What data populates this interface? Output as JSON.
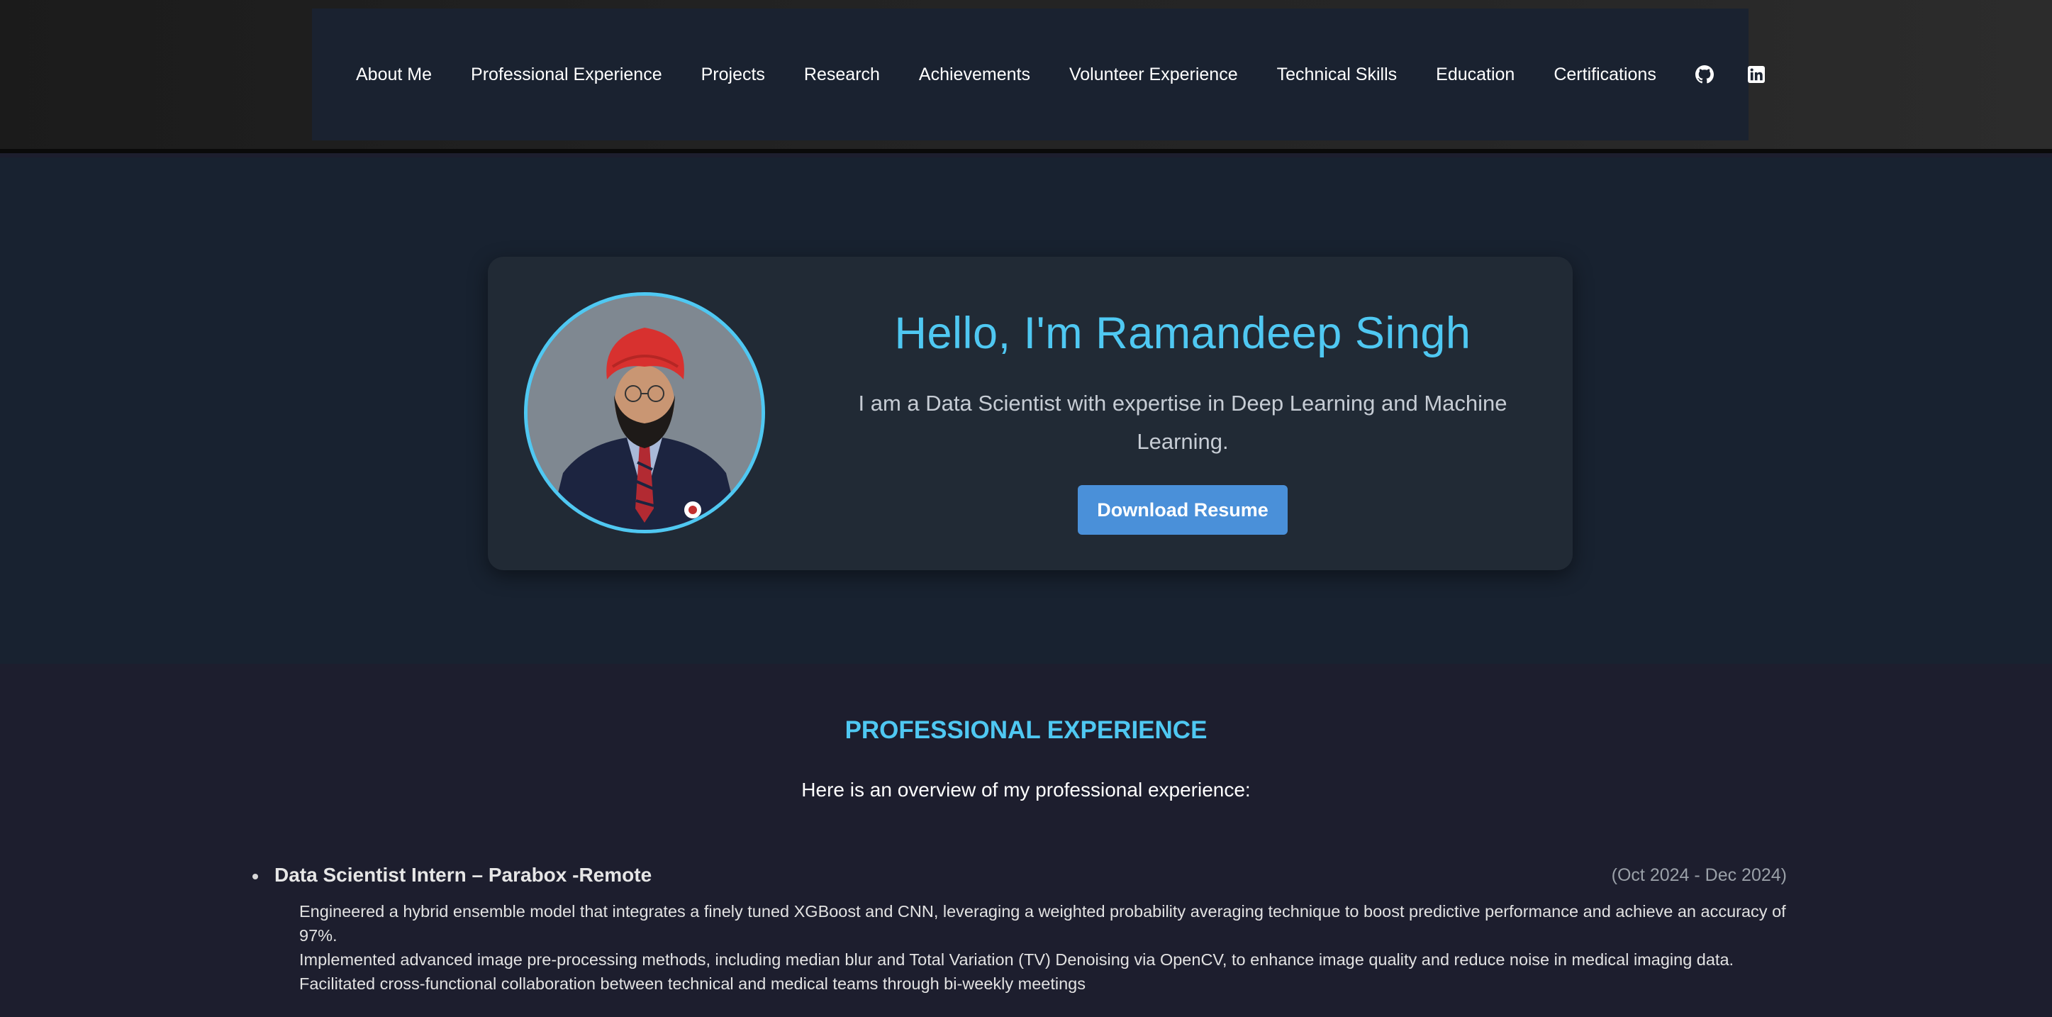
{
  "nav": {
    "items": [
      {
        "label": "About Me"
      },
      {
        "label": "Professional Experience"
      },
      {
        "label": "Projects"
      },
      {
        "label": "Research"
      },
      {
        "label": "Achievements"
      },
      {
        "label": "Volunteer Experience"
      },
      {
        "label": "Technical Skills"
      },
      {
        "label": "Education"
      },
      {
        "label": "Certifications"
      }
    ],
    "icons": [
      "github-icon",
      "linkedin-icon"
    ]
  },
  "hero": {
    "title": "Hello, I'm Ramandeep Singh",
    "subtitle": "I am a Data Scientist with expertise in Deep Learning and Machine Learning.",
    "button_label": "Download Resume"
  },
  "experience": {
    "title": "PROFESSIONAL EXPERIENCE",
    "subtitle": "Here is an overview of my professional experience:",
    "items": [
      {
        "role": "Data Scientist Intern – Parabox -Remote",
        "dates": "(Oct 2024 - Dec 2024)",
        "bullets": [
          "Engineered a hybrid ensemble model that integrates a finely tuned XGBoost and CNN, leveraging a weighted probability averaging technique to boost predictive performance and achieve an accuracy of 97%.",
          "Implemented advanced image pre-processing methods, including median blur and Total Variation (TV) Denoising via OpenCV, to enhance image quality and reduce noise in medical imaging data.",
          "Facilitated cross-functional collaboration between technical and medical teams through bi-weekly meetings"
        ]
      }
    ]
  },
  "colors": {
    "accent": "#4fc8f2",
    "button": "#4a90d9",
    "hero_bg": "#182230",
    "card_bg": "#212a35",
    "section_bg": "#1d1e2e",
    "nav_bg": "#1a2230"
  }
}
